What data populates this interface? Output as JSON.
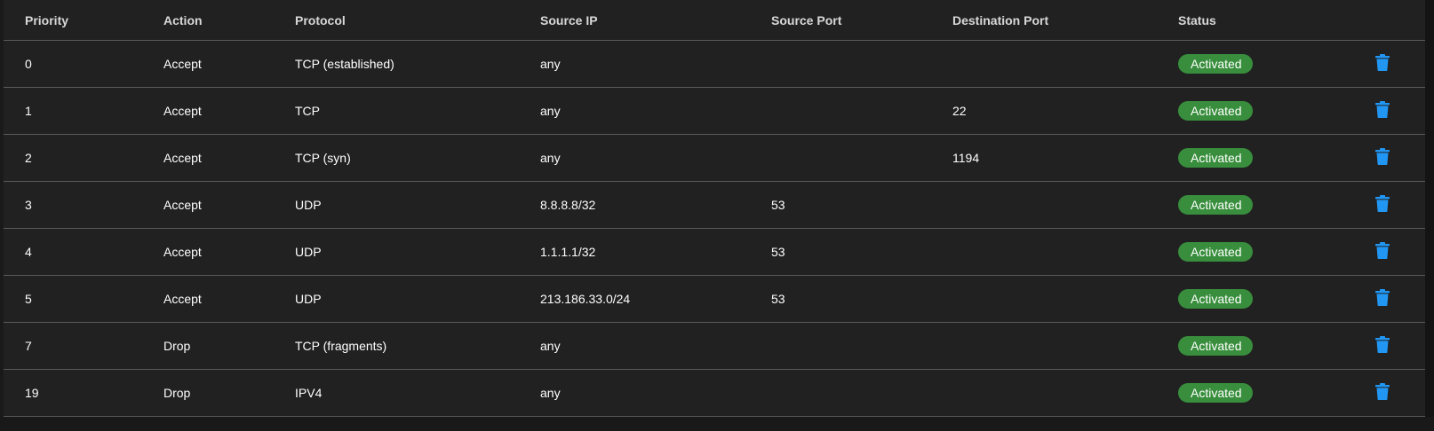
{
  "colors": {
    "background": "#212121",
    "status_active": "#388e3c",
    "delete_icon": "#2196f3",
    "divider": "#5a5a5a"
  },
  "table": {
    "headers": {
      "priority": "Priority",
      "action": "Action",
      "protocol": "Protocol",
      "source_ip": "Source IP",
      "source_port": "Source Port",
      "destination_port": "Destination Port",
      "status": "Status"
    },
    "rows": [
      {
        "priority": "0",
        "action": "Accept",
        "protocol": "TCP (established)",
        "source_ip": "any",
        "source_port": "",
        "destination_port": "",
        "status": "Activated",
        "delete_icon": "trash-icon"
      },
      {
        "priority": "1",
        "action": "Accept",
        "protocol": "TCP",
        "source_ip": "any",
        "source_port": "",
        "destination_port": "22",
        "status": "Activated",
        "delete_icon": "trash-icon"
      },
      {
        "priority": "2",
        "action": "Accept",
        "protocol": "TCP (syn)",
        "source_ip": "any",
        "source_port": "",
        "destination_port": "1194",
        "status": "Activated",
        "delete_icon": "trash-icon"
      },
      {
        "priority": "3",
        "action": "Accept",
        "protocol": "UDP",
        "source_ip": "8.8.8.8/32",
        "source_port": "53",
        "destination_port": "",
        "status": "Activated",
        "delete_icon": "trash-icon"
      },
      {
        "priority": "4",
        "action": "Accept",
        "protocol": "UDP",
        "source_ip": "1.1.1.1/32",
        "source_port": "53",
        "destination_port": "",
        "status": "Activated",
        "delete_icon": "trash-icon"
      },
      {
        "priority": "5",
        "action": "Accept",
        "protocol": "UDP",
        "source_ip": "213.186.33.0/24",
        "source_port": "53",
        "destination_port": "",
        "status": "Activated",
        "delete_icon": "trash-icon"
      },
      {
        "priority": "7",
        "action": "Drop",
        "protocol": "TCP (fragments)",
        "source_ip": "any",
        "source_port": "",
        "destination_port": "",
        "status": "Activated",
        "delete_icon": "trash-icon"
      },
      {
        "priority": "19",
        "action": "Drop",
        "protocol": "IPV4",
        "source_ip": "any",
        "source_port": "",
        "destination_port": "",
        "status": "Activated",
        "delete_icon": "trash-icon"
      }
    ]
  }
}
